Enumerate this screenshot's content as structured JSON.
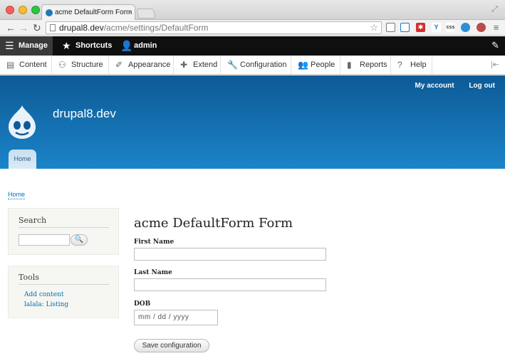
{
  "browser": {
    "tab_title": "acme DefaultForm Form | ",
    "tab_close": "×",
    "url_domain": "drupal8.dev",
    "url_path": "/acme/settings/DefaultForm",
    "extensions": [
      "cast-icon",
      "screenshot-icon",
      "lastpass-icon",
      "y-icon",
      "css-icon",
      "cloud-icon",
      "record-icon",
      "menu-icon"
    ],
    "ext_labels": {
      "lastpass": "✱",
      "y": "Y",
      "css": "css",
      "menu": "≡"
    }
  },
  "admin_bar": {
    "manage": "Manage",
    "shortcuts": "Shortcuts",
    "admin": "admin"
  },
  "admin_tray": {
    "items": [
      "Content",
      "Structure",
      "Appearance",
      "Extend",
      "Configuration",
      "People",
      "Reports",
      "Help"
    ]
  },
  "header": {
    "site_name": "drupal8.dev",
    "my_account": "My account",
    "log_out": "Log out",
    "home_tab": "Home"
  },
  "breadcrumb": "Home",
  "sidebar": {
    "search_title": "Search",
    "search_button": "🔍",
    "tools_title": "Tools",
    "tools_links": [
      "Add content",
      "lalala: Listing"
    ]
  },
  "form": {
    "title": "acme DefaultForm Form",
    "first_name_label": "First Name",
    "last_name_label": "Last Name",
    "dob_label": "DOB",
    "dob_placeholder": "mm / dd / yyyy",
    "submit": "Save configuration"
  }
}
